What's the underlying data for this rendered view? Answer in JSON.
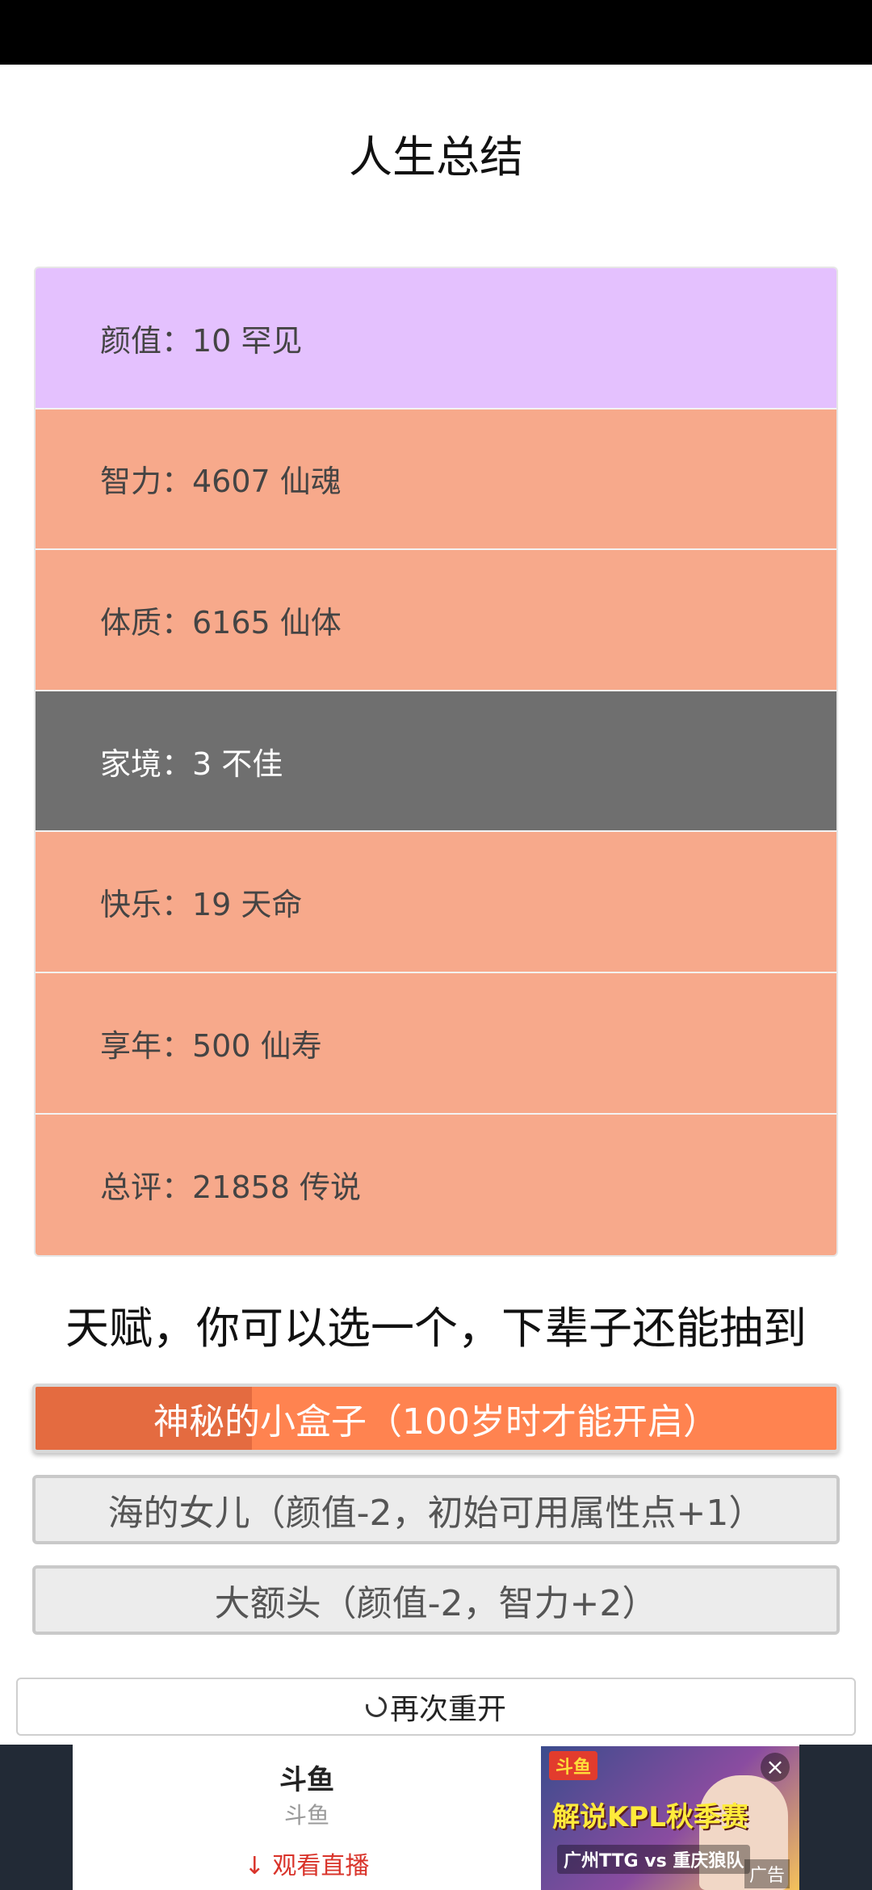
{
  "page": {
    "title": "人生总结"
  },
  "stats": [
    {
      "label": "颜值：10 罕见",
      "bg": "#e4c1fe",
      "dark": false
    },
    {
      "label": "智力：4607 仙魂",
      "bg": "#f7a98b",
      "dark": false
    },
    {
      "label": "体质：6165 仙体",
      "bg": "#f7a98b",
      "dark": false
    },
    {
      "label": "家境：3 不佳",
      "bg": "#6f6f6f",
      "dark": true
    },
    {
      "label": "快乐：19 天命",
      "bg": "#f7a98b",
      "dark": false
    },
    {
      "label": "享年：500 仙寿",
      "bg": "#f7a98b",
      "dark": false
    },
    {
      "label": "总评：21858 传说",
      "bg": "#f7a98b",
      "dark": false
    }
  ],
  "talents": {
    "heading": "天赋，你可以选一个，下辈子还能抽到",
    "options": [
      {
        "label": "神秘的小盒子（100岁时才能开启）",
        "selected": true
      },
      {
        "label": "海的女儿（颜值-2，初始可用属性点+1）",
        "selected": false
      },
      {
        "label": "大额头（颜值-2，智力+2）",
        "selected": false
      }
    ]
  },
  "restart": {
    "label": "再次重开",
    "icon": "refresh-icon"
  },
  "ad": {
    "name": "斗鱼",
    "subtitle": "斗鱼",
    "action": "观看直播",
    "action_icon": "download-arrow-icon",
    "image_logo": "斗鱼",
    "image_headline": "解说KPL秋季赛",
    "image_match": "广州TTG vs 重庆狼队",
    "tag": "广告",
    "close_icon": "close-icon"
  }
}
